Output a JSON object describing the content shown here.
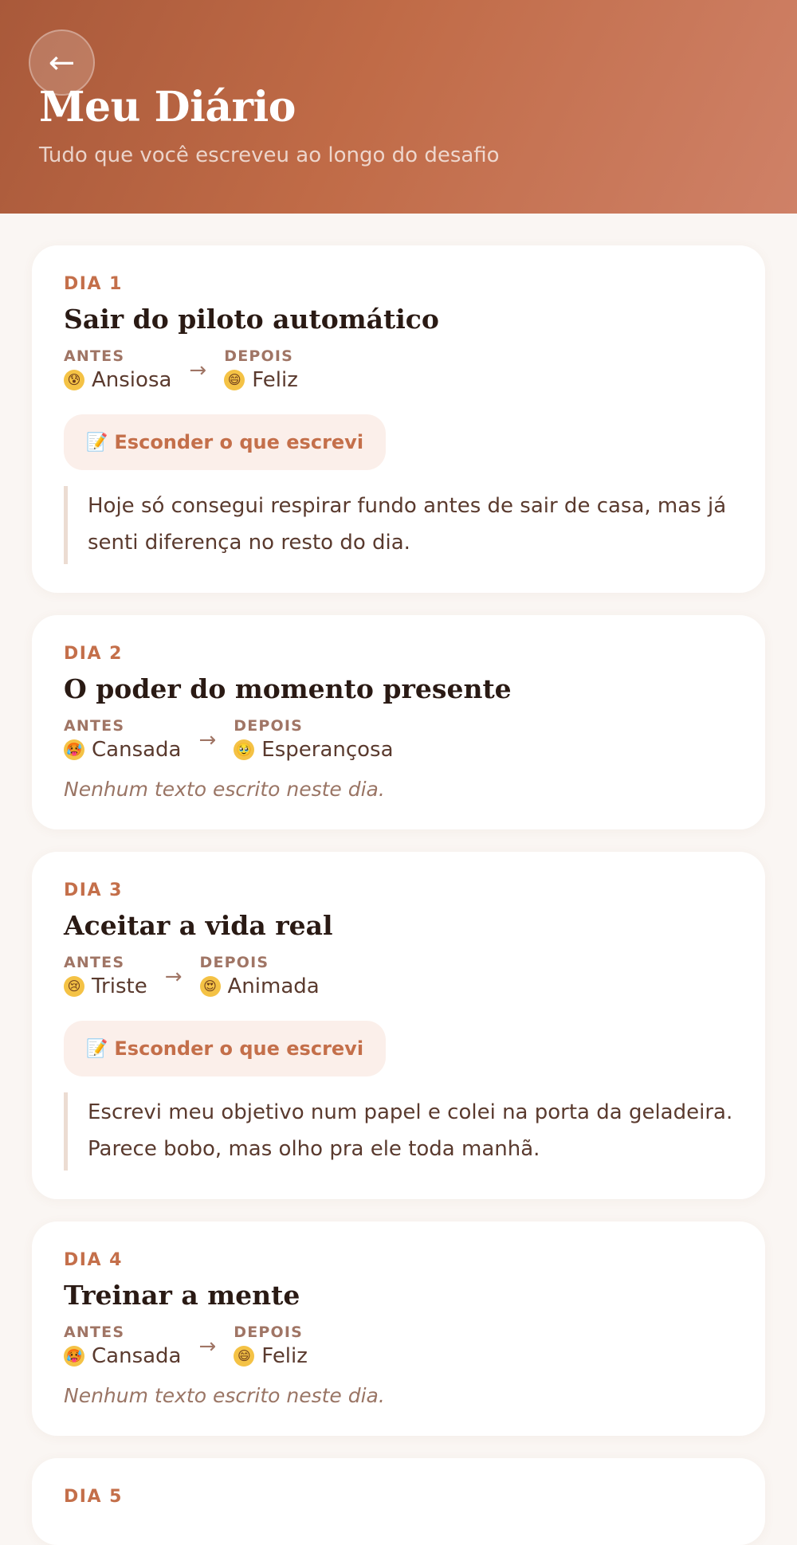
{
  "header": {
    "back_icon": "←",
    "title": "Meu Diário",
    "subtitle": "Tudo que você escreveu ao longo do desafio"
  },
  "labels": {
    "before": "ANTES",
    "after": "DEPOIS",
    "arrow": "→"
  },
  "days": [
    {
      "label": "DIA 1",
      "title": "Sair do piloto automático",
      "before": {
        "emoji": "😰",
        "mood": "Ansiosa"
      },
      "after": {
        "emoji": "😄",
        "mood": "Feliz"
      },
      "toggle": "Esconder o que escrevi",
      "toggle_icon": "📝",
      "text": "Hoje só consegui respirar fundo antes de sair de casa, mas já senti diferença no resto do dia."
    },
    {
      "label": "DIA 2",
      "title": "O poder do momento presente",
      "before": {
        "emoji": "🥵",
        "mood": "Cansada"
      },
      "after": {
        "emoji": "🥹",
        "mood": "Esperançosa"
      },
      "empty": "Nenhum texto escrito neste dia."
    },
    {
      "label": "DIA 3",
      "title": "Aceitar a vida real",
      "before": {
        "emoji": "😢",
        "mood": "Triste"
      },
      "after": {
        "emoji": "😍",
        "mood": "Animada"
      },
      "toggle": "Esconder o que escrevi",
      "toggle_icon": "📝",
      "text": "Escrevi meu objetivo num papel e colei na porta da geladeira. Parece bobo, mas olho pra ele toda manhã."
    },
    {
      "label": "DIA 4",
      "title": "Treinar a mente",
      "before": {
        "emoji": "🥵",
        "mood": "Cansada"
      },
      "after": {
        "emoji": "😄",
        "mood": "Feliz"
      },
      "empty": "Nenhum texto escrito neste dia."
    },
    {
      "label": "DIA 5"
    }
  ],
  "colors": {
    "accent": "#c46f4a",
    "header_start": "#a9593a",
    "header_end": "#cf8167",
    "background": "#faf6f3"
  }
}
